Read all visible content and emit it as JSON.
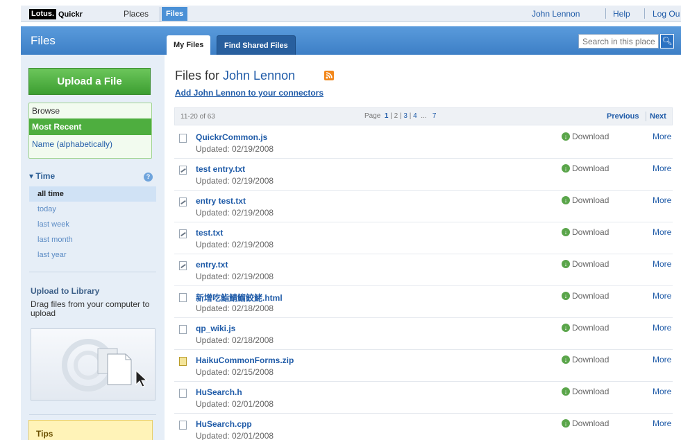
{
  "topbar": {
    "logo_lotus": "Lotus.",
    "logo_quickr": "Quickr",
    "places": "Places",
    "files": "Files",
    "user": "John Lennon",
    "help": "Help",
    "logout": "Log Ou"
  },
  "header": {
    "title": "Files",
    "tabs": [
      {
        "label": "My Files"
      },
      {
        "label": "Find Shared Files"
      }
    ],
    "search_placeholder": "Search in this place"
  },
  "sidebar": {
    "upload_label": "Upload a File",
    "browse_header": "Browse",
    "browse_options": [
      "Most Recent",
      "Name (alphabetically)"
    ],
    "time_header": "▾ Time",
    "time_options": [
      "all time",
      "today",
      "last week",
      "last month",
      "last year"
    ],
    "library_header": "Upload to Library",
    "library_desc": "Drag files from your computer to upload",
    "tips": "Tips"
  },
  "main": {
    "title_prefix": "Files for ",
    "title_name": "John Lennon",
    "add_link": "Add John Lennon to your connectors",
    "pager": {
      "range": "11-20 of 63",
      "page_label": "Page",
      "pages": [
        "1",
        "2",
        "3",
        "4",
        "...",
        "7"
      ],
      "previous": "Previous",
      "next": "Next"
    },
    "download_label": "Download",
    "more_label": "More",
    "files": [
      {
        "name": "QuickrCommon.js",
        "date": "Updated: 02/19/2008",
        "icon": "doc"
      },
      {
        "name": "test entry.txt",
        "date": "Updated: 02/19/2008",
        "icon": "edit"
      },
      {
        "name": "entry test.txt",
        "date": "Updated: 02/19/2008",
        "icon": "edit"
      },
      {
        "name": "test.txt",
        "date": "Updated: 02/19/2008",
        "icon": "edit"
      },
      {
        "name": "entry.txt",
        "date": "Updated: 02/19/2008",
        "icon": "edit"
      },
      {
        "name": "新增吃鮨鯖鰡鮫鮱.html",
        "date": "Updated: 02/18/2008",
        "icon": "doc"
      },
      {
        "name": "qp_wiki.js",
        "date": "Updated: 02/18/2008",
        "icon": "doc"
      },
      {
        "name": "HaikuCommonForms.zip",
        "date": "Updated: 02/15/2008",
        "icon": "zip"
      },
      {
        "name": "HuSearch.h",
        "date": "Updated: 02/01/2008",
        "icon": "doc"
      },
      {
        "name": "HuSearch.cpp",
        "date": "Updated: 02/01/2008",
        "icon": "doc"
      }
    ]
  },
  "colors": {
    "link": "#1f5ba8",
    "band": "#4a8fd6",
    "green": "#4eae3f"
  }
}
